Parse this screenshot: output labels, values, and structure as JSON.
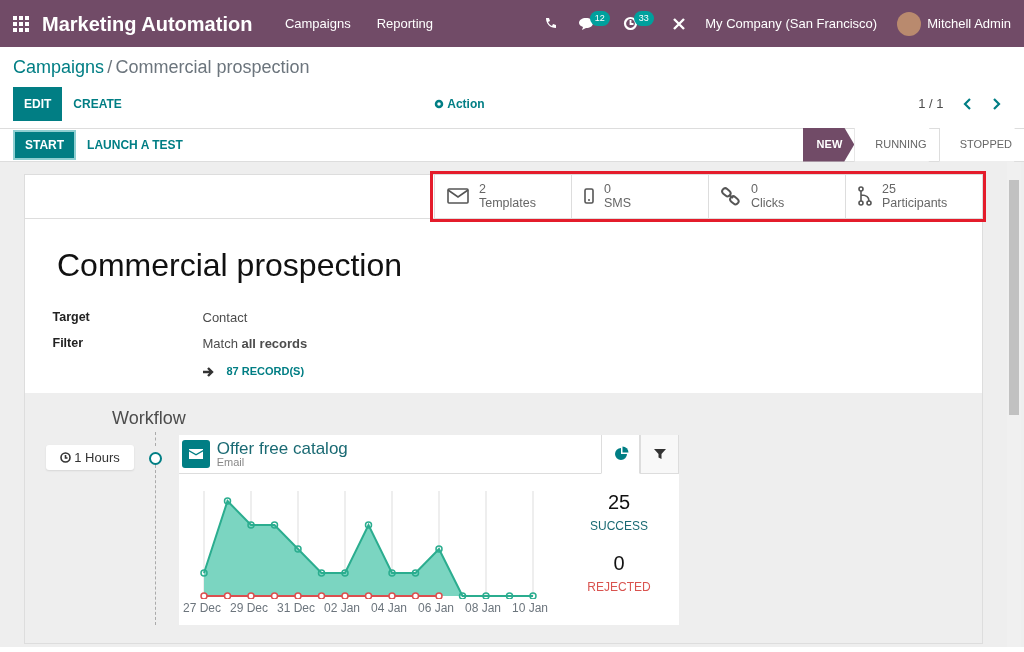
{
  "navbar": {
    "app_title": "Marketing Automation",
    "menu": [
      {
        "label": "Campaigns"
      },
      {
        "label": "Reporting"
      }
    ],
    "messages_count": "12",
    "activities_count": "33",
    "company": "My Company (San Francisco)",
    "user": "Mitchell Admin"
  },
  "breadcrumb": {
    "parent": "Campaigns",
    "separator": "/",
    "current": "Commercial prospection"
  },
  "control_panel": {
    "buttons": [
      {
        "label": "EDIT",
        "kind": "primary"
      },
      {
        "label": "CREATE",
        "kind": "secondary"
      }
    ],
    "action": "Action",
    "pager": "1 / 1"
  },
  "statusbar": {
    "buttons": [
      {
        "label": "START",
        "kind": "primary"
      },
      {
        "label": "LAUNCH A TEST",
        "kind": "secondary"
      }
    ],
    "stages": [
      {
        "label": "NEW",
        "selected": true
      },
      {
        "label": "RUNNING",
        "selected": false
      },
      {
        "label": "STOPPED",
        "selected": false
      }
    ]
  },
  "stat_buttons_highlighted": true,
  "stat_buttons": [
    {
      "kind": "envelope",
      "value": "2",
      "label": "Templates"
    },
    {
      "kind": "mobile",
      "value": "0",
      "label": "SMS"
    },
    {
      "kind": "link",
      "value": "0",
      "label": "Clicks"
    },
    {
      "kind": "branch",
      "value": "25",
      "label": "Participants"
    }
  ],
  "title": "Commercial prospection",
  "fields": [
    {
      "label": "Target",
      "value": "Contact"
    },
    {
      "label": "Filter",
      "value": "Match **all records**"
    }
  ],
  "records_link": "87 RECORD(S)",
  "workflow": {
    "title": "Workflow",
    "activities": [
      {
        "trigger": "1 Hours",
        "title": "Offer free catalog",
        "type": "Email",
        "tabs": [
          {
            "kind": "pie",
            "selected": true
          },
          {
            "kind": "filter",
            "selected": false
          }
        ],
        "x_labels": [
          "27 Dec",
          "29 Dec",
          "31 Dec",
          "02 Jan",
          "04 Jan",
          "06 Jan",
          "08 Jan",
          "10 Jan"
        ],
        "success_count": "25",
        "success_label": "SUCCESS",
        "rejected_count": "0",
        "rejected_label": "REJECTED"
      }
    ]
  }
}
